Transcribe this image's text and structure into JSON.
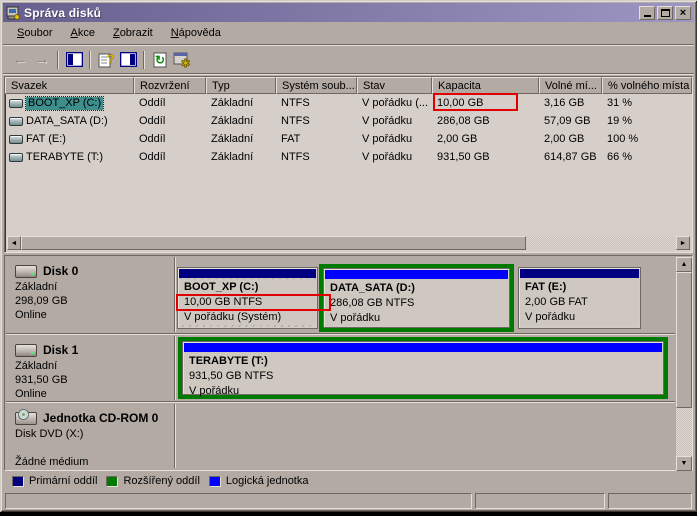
{
  "window": {
    "title": "Správa disků",
    "controls": {
      "minimize": "minimize",
      "maximize": "maximize",
      "close": "close"
    }
  },
  "menu": {
    "items": [
      {
        "accel": "S",
        "rest": "oubor"
      },
      {
        "accel": "A",
        "rest": "kce"
      },
      {
        "accel": "Z",
        "rest": "obrazit"
      },
      {
        "accel": "N",
        "rest": "ápověda"
      }
    ]
  },
  "toolbar": {
    "icons": [
      "back-icon",
      "forward-icon",
      "show-console-tree-icon",
      "help-icon",
      "show-action-pane-icon",
      "refresh-icon",
      "rescan-disks-icon"
    ]
  },
  "volume_list": {
    "columns": [
      "Svazek",
      "Rozvržení",
      "Typ",
      "Systém soub...",
      "Stav",
      "Kapacita",
      "Volné mí...",
      "% volného místa"
    ],
    "rows": [
      {
        "cells": [
          "BOOT_XP (C:)",
          "Oddíl",
          "Základní",
          "NTFS",
          "V pořádku (...",
          "10,00 GB",
          "3,16 GB",
          "31 %"
        ],
        "selected": true
      },
      {
        "cells": [
          "DATA_SATA (D:)",
          "Oddíl",
          "Základní",
          "NTFS",
          "V pořádku",
          "286,08 GB",
          "57,09 GB",
          "19 %"
        ],
        "selected": false
      },
      {
        "cells": [
          "FAT (E:)",
          "Oddíl",
          "Základní",
          "FAT",
          "V pořádku",
          "2,00 GB",
          "2,00 GB",
          "100 %"
        ],
        "selected": false
      },
      {
        "cells": [
          "TERABYTE (T:)",
          "Oddíl",
          "Základní",
          "NTFS",
          "V pořádku",
          "931,50 GB",
          "614,87 GB",
          "66 %"
        ],
        "selected": false
      }
    ]
  },
  "graphical_view": {
    "disk0": {
      "name": "Disk 0",
      "type": "Základní",
      "capacity": "298,09 GB",
      "status": "Online",
      "partitions": [
        {
          "name": "BOOT_XP  (C:)",
          "size": "10,00 GB NTFS",
          "status": "V pořádku (Systém)",
          "kind": "primary",
          "selected": true
        },
        {
          "name": "DATA_SATA  (D:)",
          "size": "286,08 GB NTFS",
          "status": "V pořádku",
          "kind": "logical",
          "selected": false
        },
        {
          "name": "FAT  (E:)",
          "size": "2,00 GB FAT",
          "status": "V pořádku",
          "kind": "primary",
          "selected": false
        }
      ]
    },
    "disk1": {
      "name": "Disk 1",
      "type": "Základní",
      "capacity": "931,50 GB",
      "status": "Online",
      "partitions": [
        {
          "name": "TERABYTE  (T:)",
          "size": "931,50 GB NTFS",
          "status": "V pořádku",
          "kind": "logical",
          "selected": false
        }
      ]
    },
    "cdrom": {
      "name": "Jednotka CD-ROM 0",
      "line1": "Disk DVD (X:)",
      "line2": "Žádné médium"
    }
  },
  "legend": {
    "items": [
      {
        "label": "Primární oddíl",
        "color": "#000080"
      },
      {
        "label": "Rozšířený oddíl",
        "color": "#007a00"
      },
      {
        "label": "Logická jednotka",
        "color": "#0000ff"
      }
    ]
  },
  "colors": {
    "primary_partition": "#000080",
    "extended_partition": "#007a00",
    "logical_drive": "#0000ff",
    "annotation": "#e00000",
    "titlebar_left": "#67608f",
    "titlebar_right": "#9d96c2",
    "selection": "#3f8e8e"
  }
}
